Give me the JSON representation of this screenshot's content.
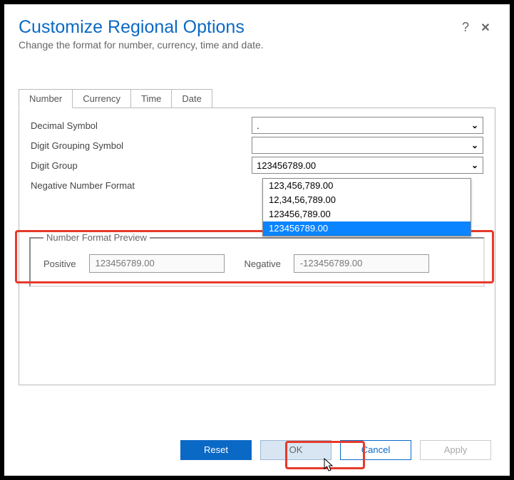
{
  "title": "Customize Regional Options",
  "subtitle": "Change the format for number, currency, time and date.",
  "tabs": [
    "Number",
    "Currency",
    "Time",
    "Date"
  ],
  "activeTab": 0,
  "fields": {
    "decimal": {
      "label": "Decimal Symbol",
      "value": "."
    },
    "grouping": {
      "label": "Digit Grouping Symbol",
      "value": ""
    },
    "group": {
      "label": "Digit Group",
      "value": "123456789.00"
    },
    "negative": {
      "label": "Negative Number Format",
      "value": ""
    }
  },
  "groupOptions": [
    "123,456,789.00",
    "12,34,56,789.00",
    "123456,789.00",
    "123456789.00"
  ],
  "groupSelected": 3,
  "preview": {
    "legend": "Number Format Preview",
    "positiveLabel": "Positive",
    "positiveValue": "123456789.00",
    "negativeLabel": "Negative",
    "negativeValue": "-123456789.00"
  },
  "buttons": {
    "reset": "Reset",
    "ok": "OK",
    "cancel": "Cancel",
    "apply": "Apply"
  }
}
